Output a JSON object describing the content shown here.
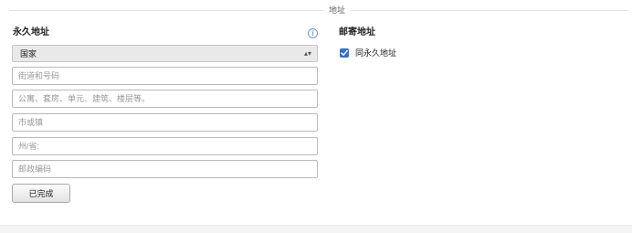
{
  "section": {
    "title": "地址"
  },
  "permanent": {
    "heading": "永久地址",
    "country_select": {
      "value": "国家"
    },
    "fields": [
      {
        "placeholder": "街道和号码"
      },
      {
        "placeholder": "公寓、套房、单元、建筑、楼层等。"
      },
      {
        "placeholder": "市或镇"
      },
      {
        "placeholder": "州/省:"
      },
      {
        "placeholder": "邮政编码"
      }
    ],
    "done_label": "已完成",
    "info_icon": "info-icon"
  },
  "mailing": {
    "heading": "邮寄地址",
    "same_as_permanent": {
      "label": "同永久地址",
      "checked": true
    }
  },
  "colors": {
    "checkbox_accent": "#2f6fd6",
    "info_icon": "#4a7cc4"
  }
}
